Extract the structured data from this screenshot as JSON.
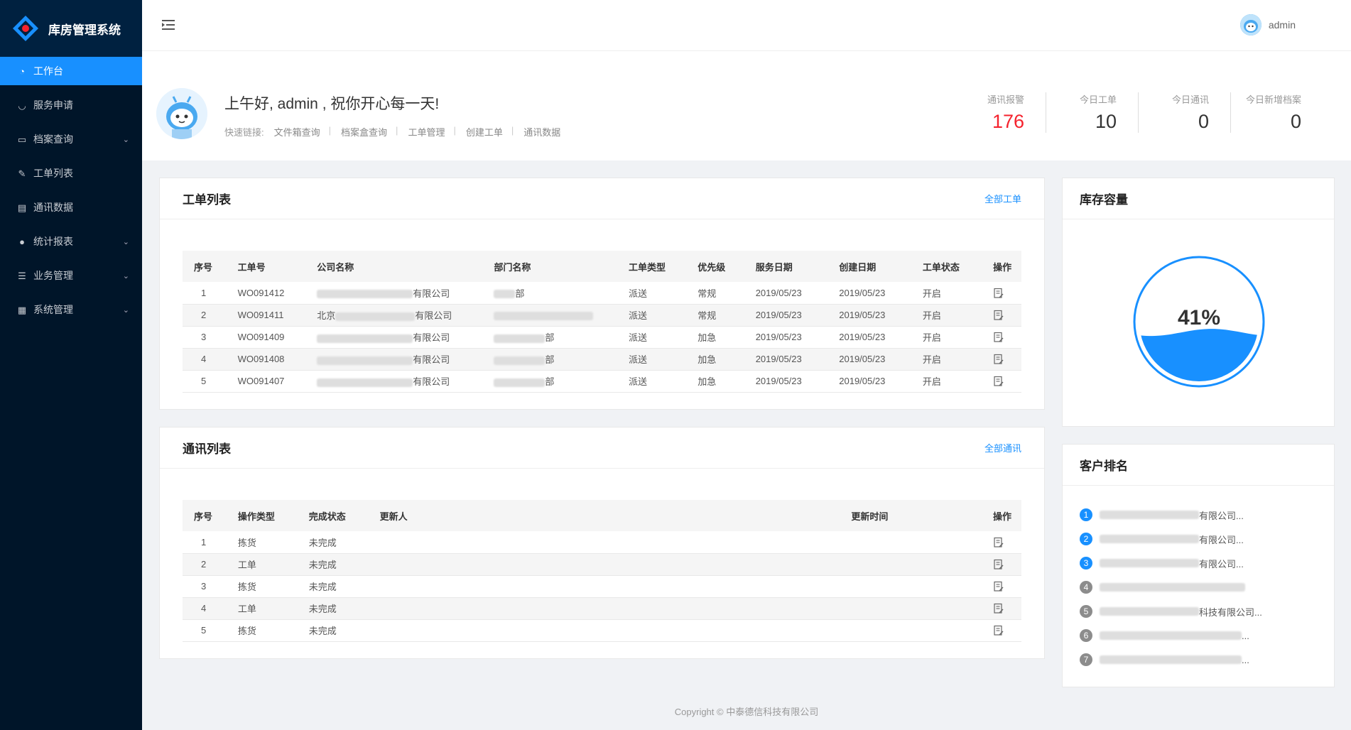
{
  "app": {
    "title": "库房管理系统"
  },
  "sidebar": {
    "items": [
      {
        "label": "工作台",
        "icon": "dashboard-icon",
        "active": true,
        "has_arrow": false
      },
      {
        "label": "服务申请",
        "icon": "headset-icon",
        "active": false,
        "has_arrow": false
      },
      {
        "label": "档案查询",
        "icon": "folder-icon",
        "active": false,
        "has_arrow": true
      },
      {
        "label": "工单列表",
        "icon": "edit-icon",
        "active": false,
        "has_arrow": false
      },
      {
        "label": "通讯数据",
        "icon": "table-icon",
        "active": false,
        "has_arrow": false
      },
      {
        "label": "统计报表",
        "icon": "check-circle-icon",
        "active": false,
        "has_arrow": true
      },
      {
        "label": "业务管理",
        "icon": "list-icon",
        "active": false,
        "has_arrow": true
      },
      {
        "label": "系统管理",
        "icon": "grid-icon",
        "active": false,
        "has_arrow": true
      }
    ]
  },
  "header": {
    "username": "admin"
  },
  "welcome": {
    "greeting": "上午好, admin , 祝你开心每一天!",
    "quick_label": "快速链接:",
    "quick_links": [
      "文件箱查询",
      "档案盒查询",
      "工单管理",
      "创建工单",
      "通讯数据"
    ]
  },
  "stats": [
    {
      "label": "通讯报警",
      "value": "176",
      "color": "#f5222d"
    },
    {
      "label": "今日工单",
      "value": "10",
      "color": "#333333"
    },
    {
      "label": "今日通讯",
      "value": "0",
      "color": "#333333"
    },
    {
      "label": "今日新增档案",
      "value": "0",
      "color": "#333333"
    }
  ],
  "work_orders": {
    "title": "工单列表",
    "link": "全部工单",
    "columns": [
      "序号",
      "工单号",
      "公司名称",
      "部门名称",
      "工单类型",
      "优先级",
      "服务日期",
      "创建日期",
      "工单状态",
      "操作"
    ],
    "rows": [
      {
        "idx": "1",
        "no": "WO091412",
        "company_prefix": "",
        "company_suffix": "有限公司",
        "dept_suffix": "部",
        "type": "派送",
        "priority": "常规",
        "service_date": "2019/05/23",
        "create_date": "2019/05/23",
        "status": "开启"
      },
      {
        "idx": "2",
        "no": "WO091411",
        "company_prefix": "北京",
        "company_suffix": "有限公司",
        "dept_suffix": "",
        "type": "派送",
        "priority": "常规",
        "service_date": "2019/05/23",
        "create_date": "2019/05/23",
        "status": "开启"
      },
      {
        "idx": "3",
        "no": "WO091409",
        "company_prefix": "",
        "company_suffix": "有限公司",
        "dept_suffix": "部",
        "type": "派送",
        "priority": "加急",
        "service_date": "2019/05/23",
        "create_date": "2019/05/23",
        "status": "开启"
      },
      {
        "idx": "4",
        "no": "WO091408",
        "company_prefix": "",
        "company_suffix": "有限公司",
        "dept_suffix": "部",
        "type": "派送",
        "priority": "加急",
        "service_date": "2019/05/23",
        "create_date": "2019/05/23",
        "status": "开启"
      },
      {
        "idx": "5",
        "no": "WO091407",
        "company_prefix": "",
        "company_suffix": "有限公司",
        "dept_suffix": "部",
        "type": "派送",
        "priority": "加急",
        "service_date": "2019/05/23",
        "create_date": "2019/05/23",
        "status": "开启"
      }
    ]
  },
  "comms": {
    "title": "通讯列表",
    "link": "全部通讯",
    "columns": [
      "序号",
      "操作类型",
      "完成状态",
      "更新人",
      "更新时间",
      "操作"
    ],
    "rows": [
      {
        "idx": "1",
        "type": "拣货",
        "status": "未完成",
        "updater": "",
        "time": ""
      },
      {
        "idx": "2",
        "type": "工单",
        "status": "未完成",
        "updater": "",
        "time": ""
      },
      {
        "idx": "3",
        "type": "拣货",
        "status": "未完成",
        "updater": "",
        "time": ""
      },
      {
        "idx": "4",
        "type": "工单",
        "status": "未完成",
        "updater": "",
        "time": ""
      },
      {
        "idx": "5",
        "type": "拣货",
        "status": "未完成",
        "updater": "",
        "time": ""
      }
    ]
  },
  "capacity": {
    "title": "库存容量",
    "percent_label": "41%",
    "percent": 0.41,
    "color": "#1890ff"
  },
  "ranking": {
    "title": "客户排名",
    "items": [
      {
        "rank": "1",
        "suffix": "有限公司...",
        "color": "#1890ff"
      },
      {
        "rank": "2",
        "suffix": "有限公司...",
        "color": "#1890ff"
      },
      {
        "rank": "3",
        "suffix": "有限公司...",
        "color": "#1890ff"
      },
      {
        "rank": "4",
        "suffix": "",
        "color": "#8c8c8c"
      },
      {
        "rank": "5",
        "suffix": "科技有限公司...",
        "color": "#8c8c8c"
      },
      {
        "rank": "6",
        "suffix": "...",
        "color": "#8c8c8c"
      },
      {
        "rank": "7",
        "suffix": "...",
        "color": "#8c8c8c"
      }
    ]
  },
  "footer": {
    "text": "Copyright © 中泰德信科技有限公司"
  }
}
